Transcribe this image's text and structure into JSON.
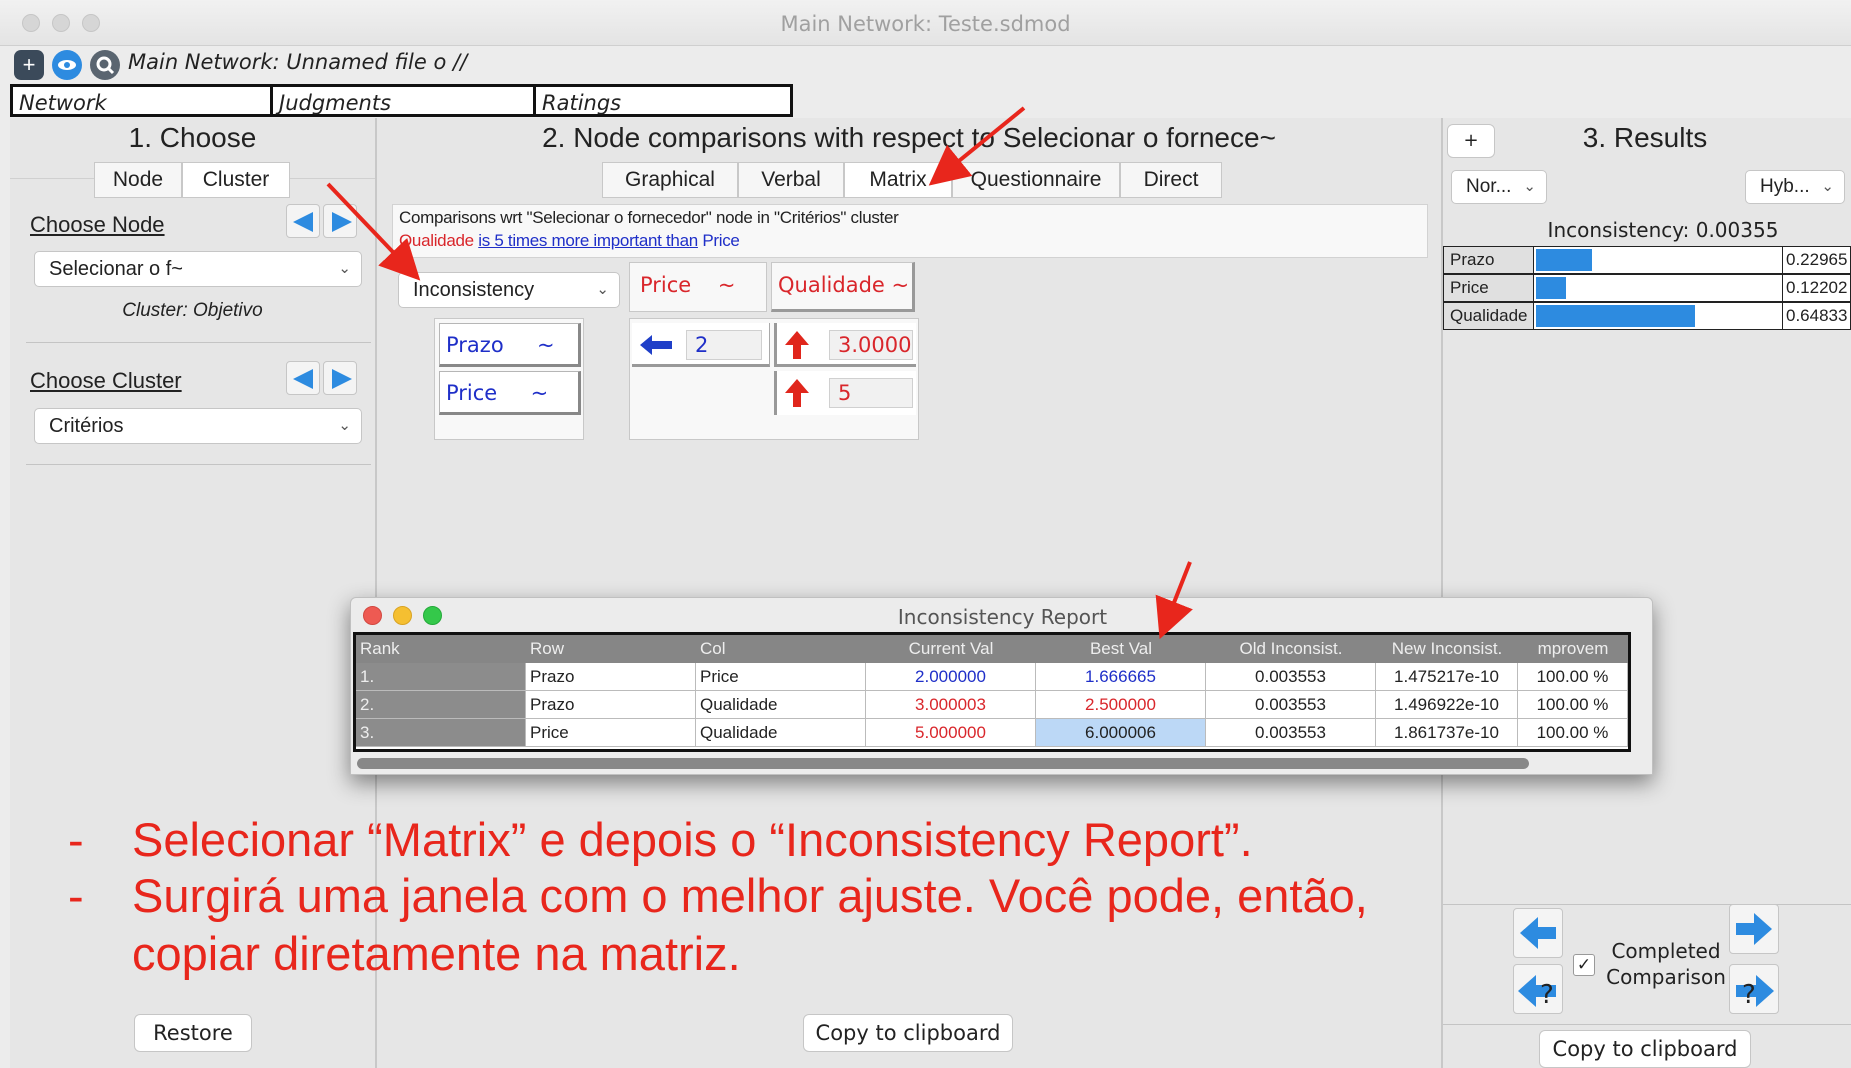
{
  "window": {
    "title": "Main Network: Teste.sdmod"
  },
  "toolbar": {
    "network_label": "Main Network: Unnamed file o //",
    "icons": [
      "plus-icon",
      "eye-icon",
      "search-icon"
    ]
  },
  "top_tabs": [
    "Network",
    "Judgments",
    "Ratings"
  ],
  "choose": {
    "title": "1. Choose",
    "seg_node": "Node",
    "seg_cluster": "Cluster",
    "choose_node_label": "Choose Node",
    "node_select": "Selecionar o f~",
    "cluster_info": "Cluster: Objetivo",
    "choose_cluster_label": "Choose Cluster",
    "cluster_select": "Critérios",
    "restore": "Restore"
  },
  "comparisons": {
    "title": "2. Node comparisons with respect to Selecionar o fornece~",
    "tabs": [
      "Graphical",
      "Verbal",
      "Matrix",
      "Questionnaire",
      "Direct"
    ],
    "selected_tab": "Matrix",
    "wrt_text": "Comparisons wrt \"Selecionar o fornecedor\" node in \"Critérios\" cluster",
    "statement": {
      "left": "Qualidade",
      "middle": "is 5 times more important than",
      "right": "Price"
    },
    "inconsistency_select": "Inconsistency",
    "col_headers": [
      "Price    ~",
      "Qualidade ~"
    ],
    "row_headers": [
      "Prazo     ~",
      "Price     ~"
    ],
    "cells": [
      "2",
      "3.0000",
      "5"
    ],
    "copy": "Copy to clipboard"
  },
  "results": {
    "title": "3. Results",
    "plus": "+",
    "select_left": "Nor...",
    "select_right": "Hyb...",
    "inconsistency": "Inconsistency: 0.00355",
    "rows": [
      {
        "label": "Prazo",
        "value": "0.22965",
        "fraction": 0.22965
      },
      {
        "label": "Price",
        "value": "0.12202",
        "fraction": 0.12202
      },
      {
        "label": "Qualidade",
        "value": "0.64833",
        "fraction": 0.64833
      }
    ],
    "completed_label_1": "Completed",
    "completed_label_2": "Comparison",
    "check": "✓",
    "question": "?",
    "copy": "Copy to clipboard"
  },
  "report": {
    "title": "Inconsistency Report",
    "headers": [
      "Rank",
      "Row",
      "Col",
      "Current Val",
      "Best Val",
      "Old Inconsist.",
      "New Inconsist.",
      "mprovem"
    ],
    "rows": [
      {
        "rank": "1.",
        "row": "Prazo",
        "col": "Price",
        "current": "2.000000",
        "best": "1.666665",
        "old": "0.003553",
        "new": "1.475217e-10",
        "improve": "100.00 %"
      },
      {
        "rank": "2.",
        "row": "Prazo",
        "col": "Qualidade",
        "current": "3.000003",
        "best": "2.500000",
        "old": "0.003553",
        "new": "1.496922e-10",
        "improve": "100.00 %"
      },
      {
        "rank": "3.",
        "row": "Price",
        "col": "Qualidade",
        "current": "5.000000",
        "best": "6.000006",
        "old": "0.003553",
        "new": "1.861737e-10",
        "improve": "100.00 %"
      }
    ]
  },
  "notes": {
    "dash": "-",
    "line1": "Selecionar “Matrix” e depois o “Inconsistency Report”.",
    "line2": "Surgirá uma janela com o melhor ajuste. Você pode, então,",
    "line3": "copiar diretamente na matriz."
  },
  "colors": {
    "accent": "#2d8be0",
    "annotation": "#e8261c",
    "red_text": "#d9262b",
    "blue_text": "#1f2fc8"
  }
}
